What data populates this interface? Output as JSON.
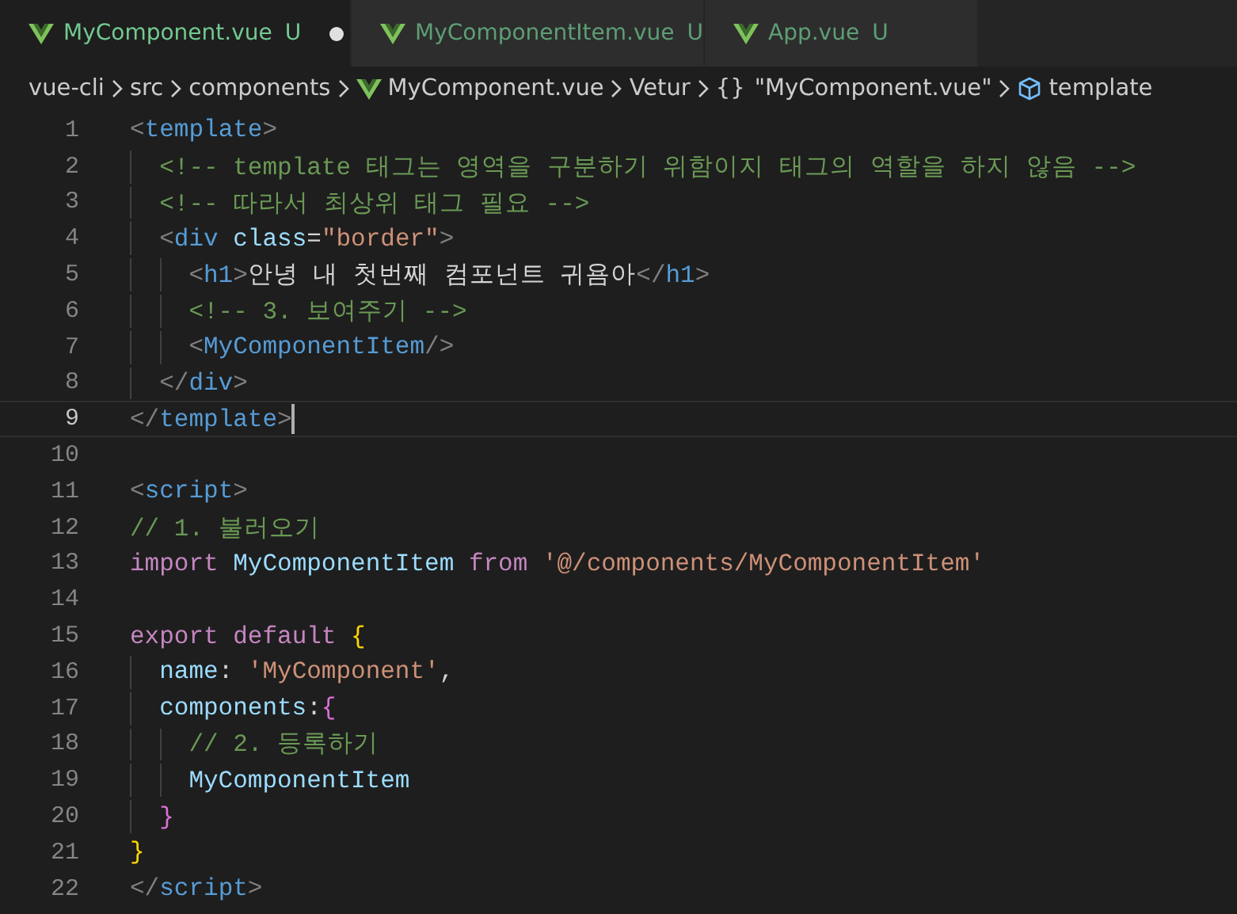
{
  "tabs": [
    {
      "label": "MyComponent.vue",
      "status": "U",
      "modified": true,
      "selected": true
    },
    {
      "label": "MyComponentItem.vue",
      "status": "U",
      "modified": false,
      "selected": false
    },
    {
      "label": "App.vue",
      "status": "U",
      "modified": false,
      "selected": false
    }
  ],
  "breadcrumb": [
    {
      "kind": "folder",
      "label": "vue-cli"
    },
    {
      "kind": "folder",
      "label": "src"
    },
    {
      "kind": "folder",
      "label": "components"
    },
    {
      "kind": "vue",
      "label": "MyComponent.vue"
    },
    {
      "kind": "folder",
      "label": "Vetur"
    },
    {
      "kind": "object",
      "symbol": "{}",
      "label": "\"MyComponent.vue\""
    },
    {
      "kind": "element",
      "label": "template"
    }
  ],
  "editor": {
    "lines": [
      {
        "number": "1",
        "current": false,
        "tokens": [
          {
            "kind": "punct",
            "text": "<"
          },
          {
            "kind": "tag",
            "text": "template"
          },
          {
            "kind": "punct",
            "text": ">"
          }
        ],
        "children": [
          {
            "number": "2",
            "current": false,
            "tokens": [
              {
                "kind": "comment",
                "text": "<!-- template 태그는 영역을 구분하기 위함이지 태그의 역할을 하지 않음 -->"
              }
            ]
          },
          {
            "number": "3",
            "current": false,
            "tokens": [
              {
                "kind": "comment",
                "text": "<!-- 따라서 최상위 태그 필요 -->"
              }
            ]
          },
          {
            "number": "4",
            "current": false,
            "tokens": [
              {
                "kind": "punct",
                "text": "<"
              },
              {
                "kind": "tag",
                "text": "div"
              },
              {
                "kind": "attr",
                "text": "class",
                "space": true
              },
              {
                "kind": "plain",
                "text": "="
              },
              {
                "kind": "string",
                "text": "\"border\""
              },
              {
                "kind": "punct",
                "text": ">"
              }
            ],
            "children": [
              {
                "number": "5",
                "current": false,
                "tokens": [
                  {
                    "kind": "punct",
                    "text": "<"
                  },
                  {
                    "kind": "tag",
                    "text": "h1"
                  },
                  {
                    "kind": "punct",
                    "text": ">"
                  },
                  {
                    "kind": "plain",
                    "text": "안녕 내 첫번째 컴포넌트 귀욤아"
                  },
                  {
                    "kind": "punct",
                    "text": "</"
                  },
                  {
                    "kind": "tag",
                    "text": "h1"
                  },
                  {
                    "kind": "punct",
                    "text": ">"
                  }
                ]
              },
              {
                "number": "6",
                "current": false,
                "tokens": [
                  {
                    "kind": "comment",
                    "text": "<!-- 3. 보여주기 -->"
                  }
                ]
              },
              {
                "number": "7",
                "current": false,
                "tokens": [
                  {
                    "kind": "punct",
                    "text": "<"
                  },
                  {
                    "kind": "tag",
                    "text": "MyComponentItem"
                  },
                  {
                    "kind": "punct",
                    "text": "/>"
                  }
                ]
              }
            ]
          },
          {
            "number": "8",
            "current": false,
            "tokens": [
              {
                "kind": "punct",
                "text": "</"
              },
              {
                "kind": "tag",
                "text": "div"
              },
              {
                "kind": "punct",
                "text": ">"
              }
            ]
          }
        ]
      },
      {
        "number": "9",
        "current": true,
        "tokens": [
          {
            "kind": "punct",
            "text": "</"
          },
          {
            "kind": "tag",
            "text": "template"
          },
          {
            "kind": "punct",
            "text": ">"
          }
        ]
      },
      {
        "number": "10",
        "current": false
      },
      {
        "number": "11",
        "current": false,
        "tokens": [
          {
            "kind": "punct",
            "text": "<"
          },
          {
            "kind": "tag",
            "text": "script"
          },
          {
            "kind": "punct",
            "text": ">"
          }
        ]
      },
      {
        "number": "12",
        "current": false,
        "tokens": [
          {
            "kind": "comment",
            "text": "// 1. 불러오기"
          }
        ]
      },
      {
        "number": "13",
        "current": false,
        "tokens": [
          {
            "kind": "keyword",
            "text": "import"
          },
          {
            "kind": "variable",
            "text": "MyComponentItem",
            "space": true
          },
          {
            "kind": "keyword",
            "text": "from",
            "space": true
          },
          {
            "kind": "string",
            "text": "'@/components/MyComponentItem'",
            "space": true
          }
        ]
      },
      {
        "number": "14",
        "current": false
      },
      {
        "number": "15",
        "current": false,
        "tokens": [
          {
            "kind": "keyword",
            "text": "export"
          },
          {
            "kind": "keyword",
            "text": "default",
            "space": true
          },
          {
            "kind": "brace1",
            "text": "{",
            "space": true
          }
        ],
        "children": [
          {
            "number": "16",
            "current": false,
            "tokens": [
              {
                "kind": "variable",
                "text": "name"
              },
              {
                "kind": "plain",
                "text": ":"
              },
              {
                "kind": "string",
                "text": "'MyComponent'",
                "space": true
              },
              {
                "kind": "plain",
                "text": ","
              }
            ]
          },
          {
            "number": "17",
            "current": false,
            "tokens": [
              {
                "kind": "variable",
                "text": "components"
              },
              {
                "kind": "plain",
                "text": ":"
              },
              {
                "kind": "brace2",
                "text": "{"
              }
            ],
            "children": [
              {
                "number": "18",
                "current": false,
                "tokens": [
                  {
                    "kind": "comment",
                    "text": "// 2. 등록하기"
                  }
                ]
              },
              {
                "number": "19",
                "current": false,
                "tokens": [
                  {
                    "kind": "variable",
                    "text": "MyComponentItem"
                  }
                ]
              }
            ]
          },
          {
            "number": "20",
            "current": false,
            "tokens": [
              {
                "kind": "brace2",
                "text": "}"
              }
            ]
          }
        ]
      },
      {
        "number": "21",
        "current": false,
        "tokens": [
          {
            "kind": "brace1",
            "text": "}"
          }
        ]
      },
      {
        "number": "22",
        "current": false,
        "tokens": [
          {
            "kind": "punct",
            "text": "</"
          },
          {
            "kind": "tag",
            "text": "script"
          },
          {
            "kind": "punct",
            "text": ">"
          }
        ]
      }
    ]
  }
}
